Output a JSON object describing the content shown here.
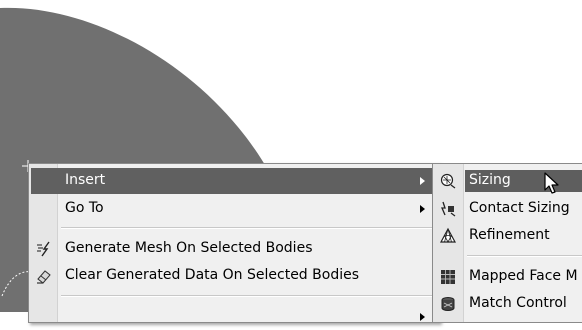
{
  "context_menu": {
    "items": [
      {
        "label": "Insert",
        "icon": "none",
        "has_submenu": true,
        "active": true
      },
      {
        "label": "Go To",
        "icon": "none",
        "has_submenu": true,
        "active": false
      },
      {
        "label": "Generate Mesh On Selected Bodies",
        "icon": "generate-mesh-icon",
        "has_submenu": false,
        "active": false
      },
      {
        "label": "Clear Generated Data On Selected Bodies",
        "icon": "clear-data-icon",
        "has_submenu": false,
        "active": false
      }
    ]
  },
  "insert_submenu": {
    "items": [
      {
        "label": "Sizing",
        "icon": "sizing-icon",
        "active": true
      },
      {
        "label": "Contact Sizing",
        "icon": "contact-sizing-icon",
        "active": false
      },
      {
        "label": "Refinement",
        "icon": "refinement-icon",
        "active": false
      },
      {
        "label": "Mapped Face M",
        "icon": "mapped-face-meshing-icon",
        "active": false
      },
      {
        "label": "Match Control",
        "icon": "match-control-icon",
        "active": false
      }
    ]
  },
  "colors": {
    "geometry_fill": "#707070",
    "menu_background": "#f0f0f0",
    "highlight": "#606060"
  }
}
